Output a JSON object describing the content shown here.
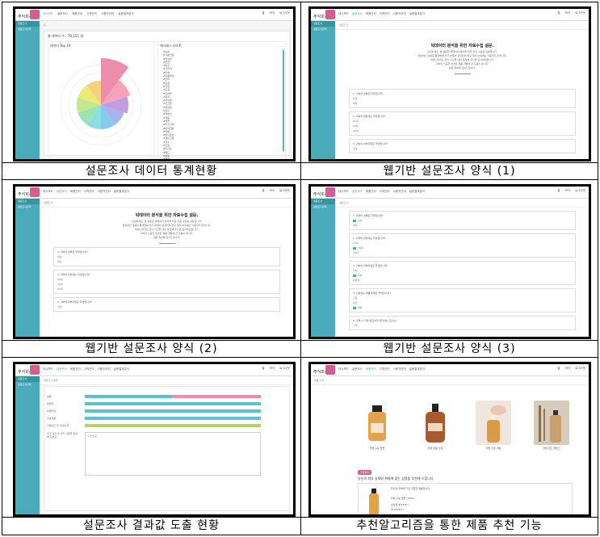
{
  "captions": [
    "설문조사 데이터 통계현황",
    "웹기반 설문조사 양식 (1)",
    "웹기반 설문조사 양식 (2)",
    "웹기반 설문조사 양식 (3)",
    "설문조사 결과값 도출 현황",
    "추천알고리즘을 통한 제품 추천 기능"
  ],
  "app": {
    "logo_text": "주식회사윌썸",
    "nav": [
      "대시보드",
      "설문조사",
      "제품관리",
      "고객관리",
      "사용자관리",
      "설문결과분석"
    ],
    "header_icons": [
      "홈",
      "마이",
      "로그아웃"
    ],
    "sidebar_main": "설문조사",
    "sidebar_sub": "설문조사관리"
  },
  "screen1": {
    "breadcrumb": "홈",
    "total_label": "총 데이터 수 : 79,151 개",
    "chart_title": "데이터 Top 10",
    "right_title": "해시태그 리스트",
    "rose_colors": [
      "#f08cab",
      "#f4a3b9",
      "#c39be0",
      "#a8b4ef",
      "#86c9f2",
      "#8adfe1",
      "#9de2b1",
      "#c5e88f",
      "#eceb78",
      "#f3d27a"
    ],
    "hashtags": [
      "#보습",
      "#수분크림",
      "#민감성",
      "#천연",
      "#비건",
      "#저자극",
      "#미백",
      "#주름개선",
      "#탄력",
      "#진정",
      "#각질",
      "#모공",
      "#트러블",
      "#피지",
      "#유수분",
      "#선크림",
      "#클렌징",
      "#토너",
      "#에센스",
      "#세럼",
      "#앰플",
      "#마스크팩",
      "#아이크림",
      "#립밤",
      "#바디로션",
      "#핸드크림",
      "#향수",
      "#오일",
      "#미스트",
      "#패드",
      "#필링",
      "#영양",
      "#광채",
      "#쿨링"
    ]
  },
  "survey": {
    "breadcrumb": "설문조사",
    "title": "빅데이터 분석을 위한 자료수집 설문.",
    "desc_lines": [
      "안녕하세요. 본 설문은 빅데이터 분석을 위한 자료 수집용 설문입니다.",
      "응답하신 내용은 통계법에 의거 비밀이 보장되며 연구 목적 이외에는 사용되지 않습니다.",
      "바쁘시더라도 잠시 시간을 내어 응답해 주시면 감사하겠습니다.",
      "귀하의 소중한 의견은 제품 개발에 큰 도움이 됩니다.",
      "설문 참여에 감사드립니다."
    ],
    "questions": [
      {
        "q": "1. 귀하의 성별은 무엇입니까?",
        "opts": [
          "남성",
          "여성"
        ]
      },
      {
        "q": "2. 귀하의 연령대는 무엇입니까?",
        "opts": [
          "20대",
          "30대",
          "40대"
        ]
      },
      {
        "q": "3. 귀하의 피부타입은 무엇입니까?",
        "opts": [
          "건성",
          "지성",
          "복합성"
        ]
      },
      {
        "q": "4. 선호하는 제품 유형은 무엇입니까?",
        "opts": [
          "크림",
          "로션",
          "세럼"
        ]
      },
      {
        "q": "5. 구매 시 가장 중요하게 생각하는 요소는?",
        "opts": [
          "가격",
          "성분",
          "브랜드"
        ]
      }
    ]
  },
  "screen5": {
    "breadcrumb": "설문조사 결과",
    "rows": [
      "성별",
      "연령대",
      "피부타입",
      "선호제품",
      "구매요인 및 자유의견"
    ],
    "textarea_label": "추가 의견 및 기타 사항을 입력해 주세요",
    "textarea_value": "의견 없음"
  },
  "screen6": {
    "breadcrumb": "제품 추천",
    "products": [
      "윌썸 수분 앰플",
      "윌썸 퍼퓸 오일",
      "윌썸 진정 세럼",
      "윌썸 핸드 에센스"
    ],
    "tag": "추천결과",
    "result_line": "당신의 피부 상태와 취향에 맞는 상품을 추천해 드립니다.",
    "detail_title": "당신의 피부에 가장 적합한 제품입니다",
    "detail_name": "윌썸 수분 앰플 (50ml)",
    "ratings": [
      "보습력 ★★★★☆",
      "향 ★★★★☆"
    ]
  }
}
